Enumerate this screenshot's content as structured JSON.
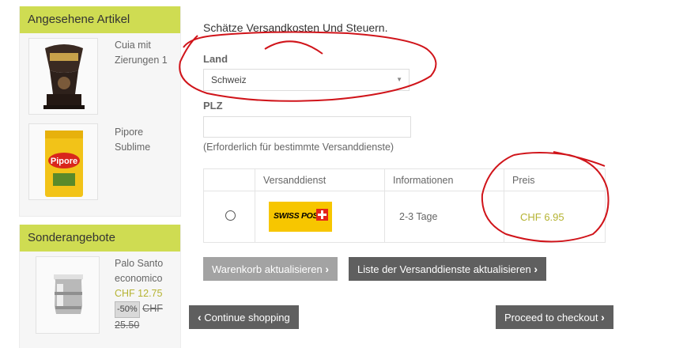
{
  "sidebar": {
    "viewed": {
      "title": "Angesehene Artikel",
      "items": [
        {
          "name": "Cuia mit Zierungen 1"
        },
        {
          "name": "Pipore Sublime"
        }
      ]
    },
    "specials": {
      "title": "Sonderangebote",
      "items": [
        {
          "name": "Palo Santo economico",
          "price": "CHF 12.75",
          "discount": "-50%",
          "old_price": "CHF 25.50"
        }
      ]
    }
  },
  "main": {
    "title": "Schätze Versandkosten Und Steuern.",
    "country_label": "Land",
    "country_value": "Schweiz",
    "zip_label": "PLZ",
    "zip_value": "",
    "zip_hint": "(Erforderlich für bestimmte Versanddienste)",
    "table": {
      "headers": [
        "",
        "Versanddienst",
        "Informationen",
        "Preis"
      ],
      "rows": [
        {
          "logo_text": "SWISS POST",
          "info": "2-3 Tage",
          "price": "CHF 6.95"
        }
      ]
    },
    "buttons": {
      "update_cart": "Warenkorb aktualisieren",
      "update_shipping": "Liste der Versanddienste aktualisieren",
      "continue": "Continue shopping",
      "checkout": "Proceed to checkout"
    }
  },
  "colors": {
    "accent_green": "#cfdc52",
    "price": "#b5b332",
    "annotation": "#d0141a"
  }
}
